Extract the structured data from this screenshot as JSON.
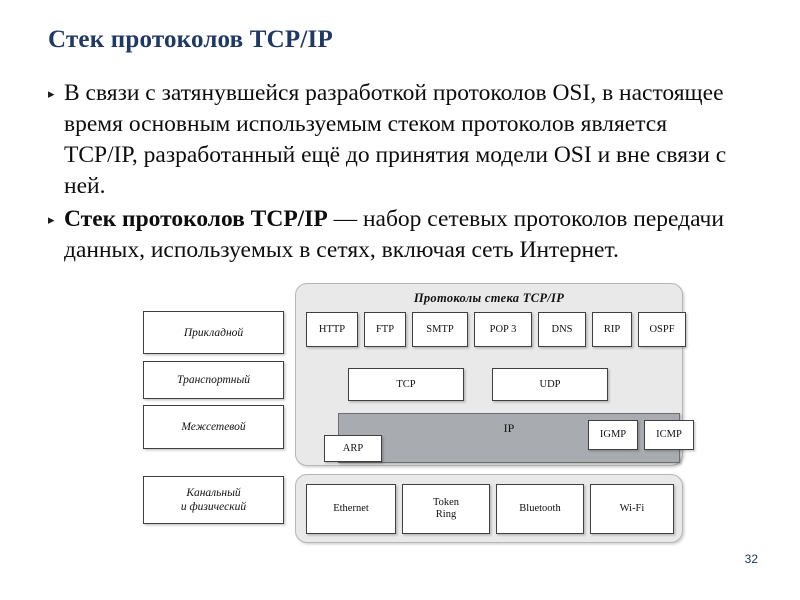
{
  "slide": {
    "title": "Стек протоколов TCP/IP",
    "page_number": "32",
    "title_color": "#1f3864",
    "background_color": "#ffffff"
  },
  "bullets": [
    {
      "marker": "▸",
      "lead": "",
      "text": "В связи с затянувшейся разработкой протоколов OSI, в настоящее время основным используемым стеком протоколов является TCP/IP, разработанный ещё до принятия модели OSI и вне связи с ней."
    },
    {
      "marker": "▸",
      "lead": "Стек протоколов TCP/IP",
      "text": " — набор сетевых протоколов передачи данных, используемых в сетях, включая сеть Интернет."
    }
  ],
  "diagram": {
    "upper_panel_heading": "Протоколы стека TCP/IP",
    "panel_background": "#e9e9e9",
    "panel_border": "#b6b6b6",
    "ip_band_color": "#a8acb1",
    "layers": [
      {
        "label": "Прикладной"
      },
      {
        "label": "Транспортный"
      },
      {
        "label": "Межсетевой"
      },
      {
        "label": "Канальный\nи физический"
      }
    ],
    "layer_labels": {
      "application": "Прикладной",
      "transport": "Транспортный",
      "internet": "Межсетевой",
      "link_line1": "Канальный",
      "link_line2": "и физический"
    },
    "application_protocols": [
      "HTTP",
      "FTP",
      "SMTP",
      "POP 3",
      "DNS",
      "RIP",
      "OSPF"
    ],
    "transport_protocols": [
      "TCP",
      "UDP"
    ],
    "internet_layer": {
      "main": "IP",
      "left": "ARP",
      "right": [
        "IGMP",
        "ICMP"
      ]
    },
    "link_protocols": [
      {
        "line1": "Ethernet",
        "line2": ""
      },
      {
        "line1": "Token",
        "line2": "Ring"
      },
      {
        "line1": "Bluetooth",
        "line2": ""
      },
      {
        "line1": "Wi-Fi",
        "line2": ""
      }
    ]
  }
}
